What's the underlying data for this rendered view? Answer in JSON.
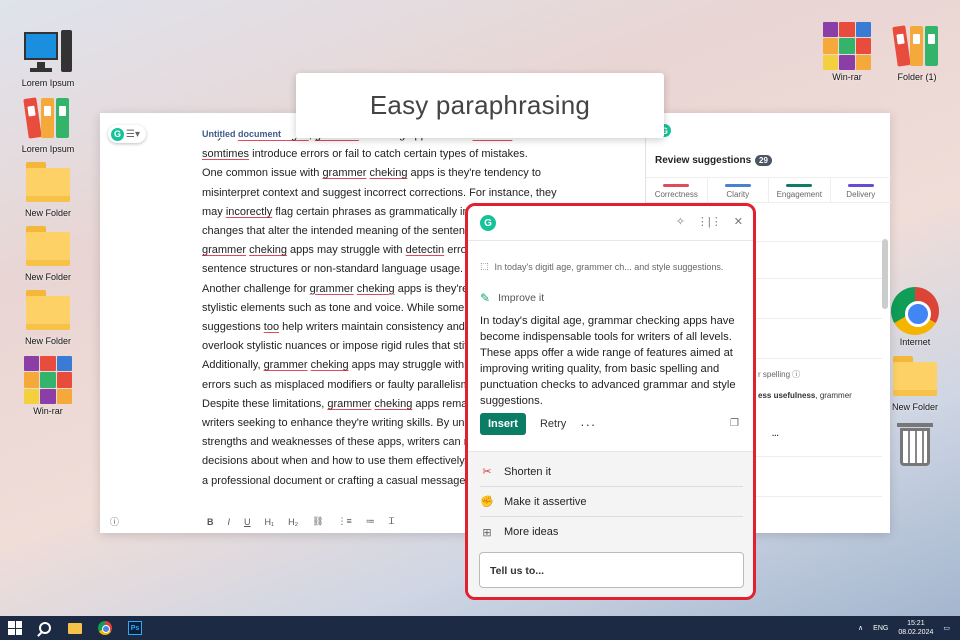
{
  "desktop": {
    "left_icons": [
      {
        "label": "Lorem Ipsum",
        "icon": "computer-icon"
      },
      {
        "label": "Lorem Ipsum",
        "icon": "binders-icon"
      },
      {
        "label": "New Folder",
        "icon": "folder-icon"
      },
      {
        "label": "New Folder",
        "icon": "folder-icon"
      },
      {
        "label": "New Folder",
        "icon": "folder-icon"
      },
      {
        "label": "Win-rar",
        "icon": "winrar-icon"
      }
    ],
    "right_icons": [
      {
        "label": "Win-rar",
        "icon": "winrar-icon"
      },
      {
        "label": "Folder (1)",
        "icon": "binders-icon"
      },
      {
        "label": "Internet",
        "icon": "chrome-icon"
      },
      {
        "label": "New Folder",
        "icon": "folder-icon"
      },
      {
        "label": "",
        "icon": "trash-icon"
      }
    ]
  },
  "callout": {
    "title": "Easy paraphrasing"
  },
  "editor": {
    "doc_title": "Untitled document",
    "lines": [
      [
        "they're ",
        {
          "e": "disadvantages"
        },
        ", ",
        {
          "e": "grammar"
        },
        " checking apps are not ",
        {
          "e": "infallible"
        },
        " and can"
      ],
      [
        {
          "e": "somtimes"
        },
        " introduce errors or fail to catch certain types of mistakes."
      ],
      [
        "One common issue with ",
        {
          "e": "grammer"
        },
        " ",
        {
          "e": "cheking"
        },
        " apps is they're tendency to"
      ],
      [
        "misinterpret context and suggest incorrect corrections. For instance, they"
      ],
      [
        "may ",
        {
          "e": "incorectly"
        },
        " flag certain phrases as grammatically incorrect or suggest"
      ],
      [
        "changes that alter the intended meaning of the sentence. Additionally,"
      ],
      [
        {
          "e": "grammer"
        },
        " ",
        {
          "e": "cheking"
        },
        " apps may struggle with ",
        {
          "e": "detectin"
        },
        " errors in complex"
      ],
      [
        "sentence structures or non-standard language usage."
      ],
      [
        "Another challenge for ",
        {
          "e": "grammer"
        },
        " ",
        {
          "e": "cheking"
        },
        " apps is they're limited ability to assess"
      ],
      [
        "stylistic elements such as tone and voice. While some apps may offer"
      ],
      [
        "suggestions ",
        {
          "e": "too"
        },
        " help writers maintain consistency and clarity, they often"
      ],
      [
        "overlook stylistic nuances or impose rigid rules that stifle creativity."
      ],
      [
        "Additionally, ",
        {
          "e": "grammer"
        },
        " ",
        {
          "e": "cheking"
        },
        " apps may struggle with identifying subtle"
      ],
      [
        "errors such as misplaced modifiers or faulty parallelism."
      ],
      [
        "Despite these limitations, ",
        {
          "e": "grammer"
        },
        " ",
        {
          "e": "cheking"
        },
        " apps remain valuable tools for"
      ],
      [
        "writers seeking to enhance they're writing skills. By understanding the"
      ],
      [
        "strengths and weaknesses of these apps, writers can make informed"
      ],
      [
        "decisions about when and how to use them effectively. Whether writing"
      ],
      [
        "a professional document or crafting a casual message, these tools"
      ]
    ],
    "format_bar": [
      "?",
      "B",
      "I",
      "U",
      "H1",
      "H2",
      "link",
      "ol",
      "ul",
      "clear"
    ]
  },
  "review": {
    "title": "Review suggestions",
    "count": "29",
    "tabs": [
      {
        "label": "Correctness",
        "color": "#e04a5b"
      },
      {
        "label": "Clarity",
        "color": "#4a7fd4"
      },
      {
        "label": "Engagement",
        "color": "#0b7d67"
      },
      {
        "label": "Delivery",
        "color": "#6a4ad4"
      }
    ],
    "snippet_spelling": "r spelling",
    "snippet_words": "ess usefulness",
    "snippet_words2": ", grammer",
    "snippet_more": "..."
  },
  "popup": {
    "quote": "In today's digitl age, grammer ch...  and style suggestions.",
    "improve_label": "Improve it",
    "body": "In today's digital age, grammar checking apps have become indispensable tools for writers of all levels. These apps offer a wide range of features aimed at improving writing quality, from basic spelling and punctuation checks to advanced grammar and style suggestions.",
    "insert_label": "Insert",
    "retry_label": "Retry",
    "more_label": "···",
    "options": [
      {
        "label": "Shorten it",
        "icon": "scissors-icon"
      },
      {
        "label": "Make it assertive",
        "icon": "fist-icon"
      },
      {
        "label": "More ideas",
        "icon": "ideas-icon"
      }
    ],
    "tell_placeholder": "Tell us to..."
  },
  "taskbar": {
    "lang": "ENG",
    "time": "15:21",
    "date": "08.02.2024"
  },
  "colors": {
    "accent": "#0b7d67",
    "highlight_border": "#e3202f",
    "error_underline": "#e04a5b"
  }
}
